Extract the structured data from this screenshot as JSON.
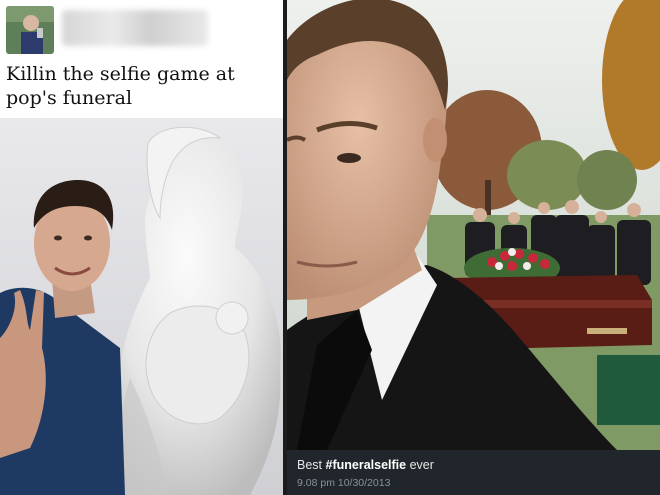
{
  "left_post": {
    "avatar_icon": "user-avatar-icon",
    "caption": "Killin the selfie game at pop's funeral"
  },
  "right_post": {
    "caption_prefix": "Best",
    "caption_hashtag": "#funeralselfie",
    "caption_suffix": "ever",
    "timestamp": "9.08 pm 10/30/2013"
  }
}
